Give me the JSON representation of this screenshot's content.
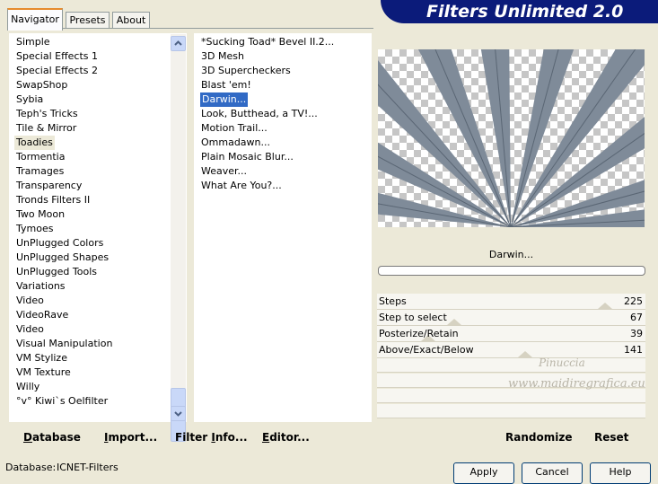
{
  "tabs": [
    "Navigator",
    "Presets",
    "About"
  ],
  "title": "Filters Unlimited 2.0",
  "categories": [
    "Simple",
    "Special Effects 1",
    "Special Effects 2",
    "SwapShop",
    "Sybia",
    "Teph's Tricks",
    "Tile & Mirror",
    "Toadies",
    "Tormentia",
    "Tramages",
    "Transparency",
    "Tronds Filters II",
    "Two Moon",
    "Tymoes",
    "UnPlugged Colors",
    "UnPlugged Shapes",
    "UnPlugged Tools",
    "Variations",
    "Video",
    "VideoRave",
    "Video",
    "Visual Manipulation",
    "VM Stylize",
    "VM Texture",
    "Willy",
    "°v° Kiwi`s Oelfilter"
  ],
  "selected_category": "Toadies",
  "filters": [
    "*Sucking Toad*  Bevel II.2...",
    "3D Mesh",
    "3D Supercheckers",
    "Blast 'em!",
    "Darwin...",
    "Look, Butthead, a TV!...",
    "Motion Trail...",
    "Ommadawn...",
    "Plain Mosaic Blur...",
    "Weaver...",
    "What Are You?..."
  ],
  "selected_filter": "Darwin...",
  "preview_label": "Darwin...",
  "parameters": [
    {
      "label": "Steps",
      "value": "225",
      "level": 0.88
    },
    {
      "label": "Step to select",
      "value": "67",
      "level": 0.26
    },
    {
      "label": "Posterize/Retain",
      "value": "39",
      "level": 0.15
    },
    {
      "label": "Above/Exact/Below",
      "value": "141",
      "level": 0.55
    }
  ],
  "watermark": {
    "line1": "Pinuccia",
    "line2": "www.maidiregrafica.eu"
  },
  "left_buttons": [
    {
      "label": "Database",
      "key": "D"
    },
    {
      "label": "Import...",
      "key": "I"
    },
    {
      "label": "Filter Info...",
      "key": "F"
    },
    {
      "label": "Editor...",
      "key": "E"
    }
  ],
  "right_buttons": [
    "Randomize",
    "Reset"
  ],
  "status": {
    "label": "Database:",
    "value": "ICNET-Filters"
  },
  "dialog_buttons": [
    "Apply",
    "Cancel",
    "Help"
  ],
  "colors": {
    "banner": "#0b1b7a",
    "selection": "#316ac5",
    "preview_rays": "#7f8b99"
  }
}
